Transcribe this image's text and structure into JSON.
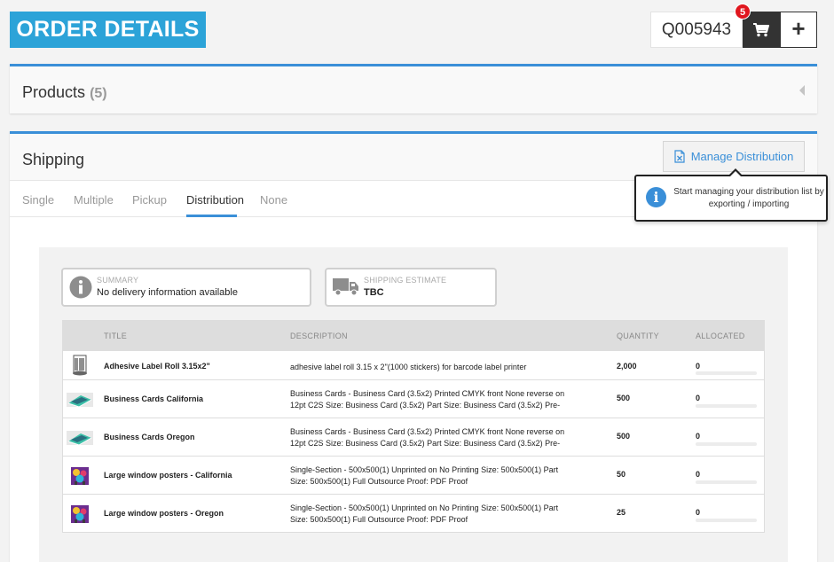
{
  "header": {
    "title": "ORDER DETAILS",
    "quote_number": "Q005943",
    "cart_count": "5",
    "add_label": "+"
  },
  "products": {
    "title": "Products",
    "count": "(5)"
  },
  "shipping": {
    "title": "Shipping",
    "manage_button": "Manage Distribution",
    "tabs": [
      "Single",
      "Multiple",
      "Pickup",
      "Distribution",
      "None"
    ],
    "active_tab": "Distribution",
    "tooltip": "Start managing your distribution list by exporting / importing",
    "summary": {
      "label": "SUMMARY",
      "value": "No delivery information available"
    },
    "estimate": {
      "label": "SHIPPING ESTIMATE",
      "value": "TBC"
    }
  },
  "table": {
    "headers": {
      "title": "TITLE",
      "description": "DESCRIPTION",
      "quantity": "QUANTITY",
      "allocated": "ALLOCATED"
    },
    "rows": [
      {
        "title": "Adhesive Label Roll 3.15x2\"",
        "description": "adhesive label roll 3.15 x 2\"(1000 stickers) for barcode label printer",
        "quantity": "2,000",
        "allocated": "0",
        "allocated_fraction": 0,
        "thumb": "label-roll-thumbnail"
      },
      {
        "title": "Business Cards California",
        "description": "Business Cards - Business Card (3.5x2) Printed CMYK front None reverse on 12pt C2S Size: Business Card (3.5x2) Part Size: Business Card (3.5x2) Pre-",
        "quantity": "500",
        "allocated": "0",
        "allocated_fraction": 0,
        "thumb": "business-card-thumbnail"
      },
      {
        "title": "Business Cards Oregon",
        "description": "Business Cards - Business Card (3.5x2) Printed CMYK front None reverse on 12pt C2S Size: Business Card (3.5x2) Part Size: Business Card (3.5x2) Pre-",
        "quantity": "500",
        "allocated": "0",
        "allocated_fraction": 0,
        "thumb": "business-card-thumbnail"
      },
      {
        "title": "Large window posters - California",
        "description": "Single-Section - 500x500(1) Unprinted on No Printing Size: 500x500(1) Part Size: 500x500(1) Full Outsource Proof: PDF Proof",
        "quantity": "50",
        "allocated": "0",
        "allocated_fraction": 0,
        "thumb": "poster-thumbnail"
      },
      {
        "title": "Large window posters - Oregon",
        "description": "Single-Section - 500x500(1) Unprinted on No Printing Size: 500x500(1) Part Size: 500x500(1) Full Outsource Proof: PDF Proof",
        "quantity": "25",
        "allocated": "0",
        "allocated_fraction": 0,
        "thumb": "poster-thumbnail"
      }
    ]
  },
  "colors": {
    "brand": "#2ca3d8",
    "accent": "#3a8fd8",
    "cart_badge": "#e0161e",
    "dark_button": "#333333"
  },
  "icons": [
    "shopping-cart-icon",
    "excel-file-icon",
    "info-icon",
    "truck-icon",
    "chevron-left-icon"
  ]
}
